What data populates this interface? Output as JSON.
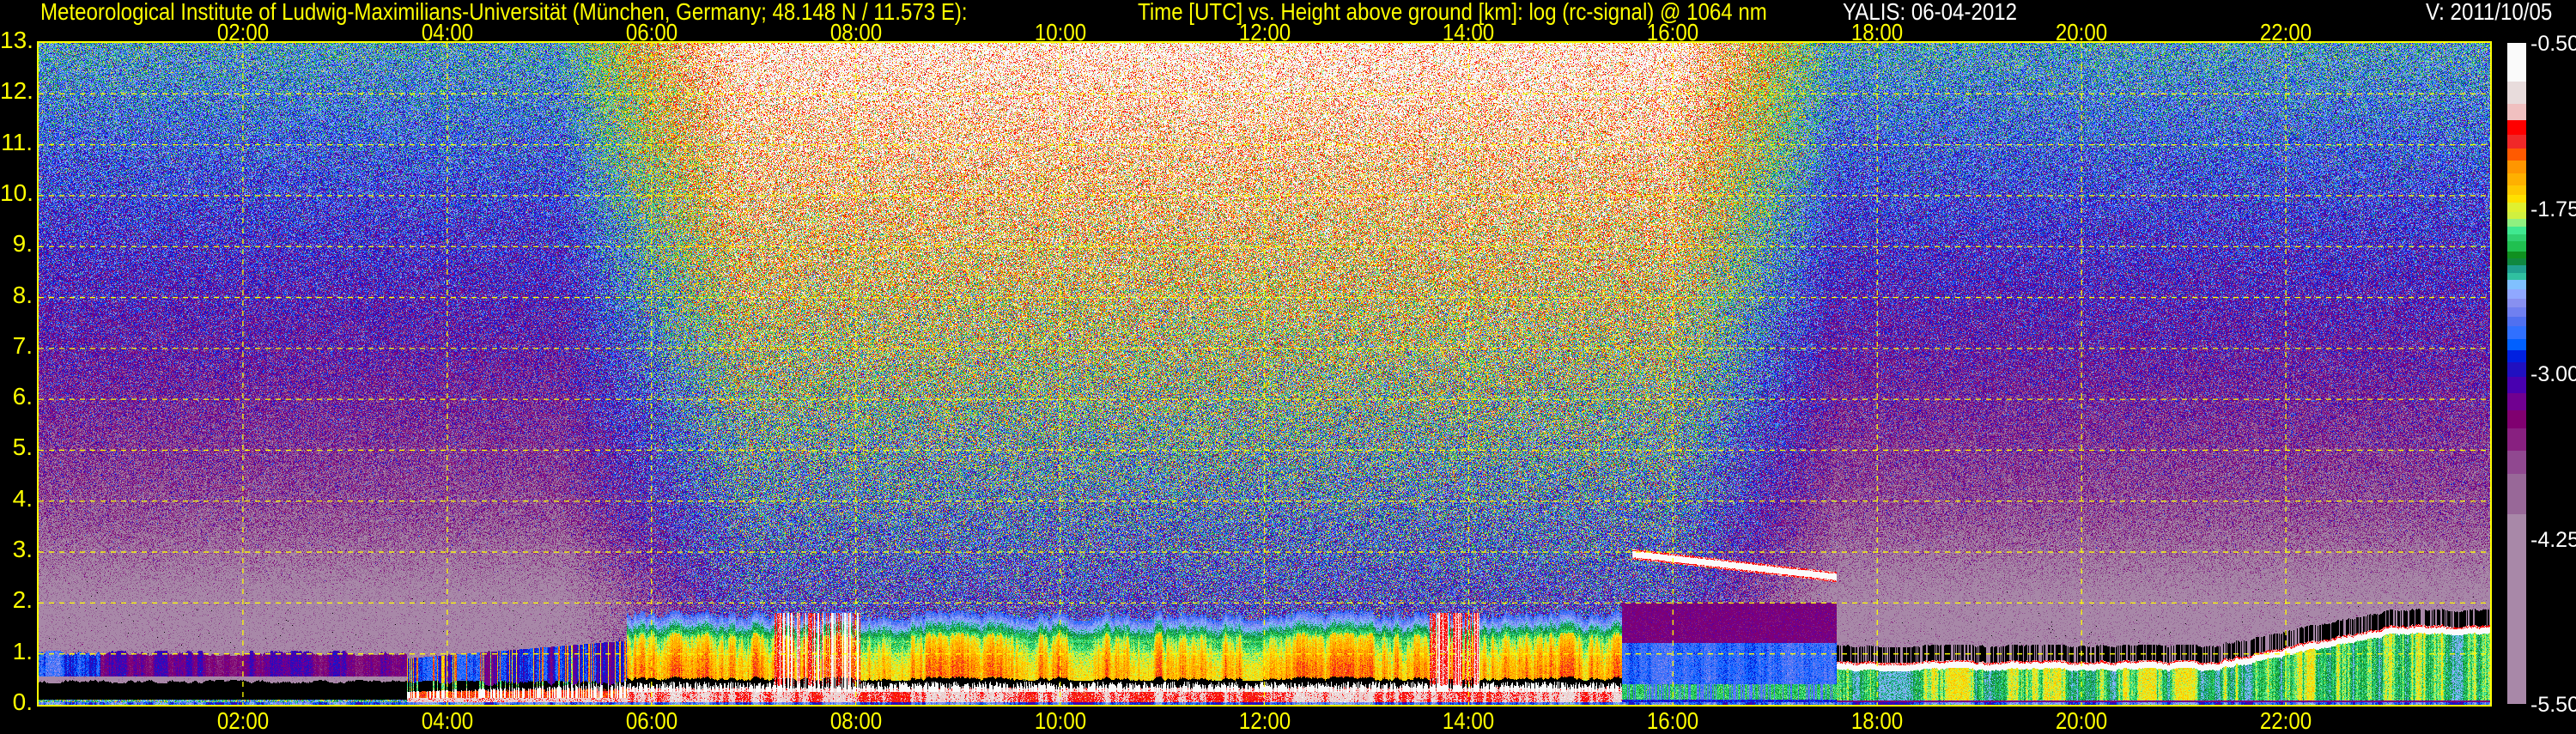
{
  "header": {
    "institute": "Meteorological Institute of Ludwig-Maximilians-Universität (München, Germany; 48.148 N / 11.573 E):",
    "plot_description": "Time [UTC] vs. Height above ground [km]: log (rc-signal) @ 1064 nm",
    "instrument_date": "YALIS: 06-04-2012",
    "version": "V: 2011/10/05"
  },
  "chart_data": {
    "type": "heatmap",
    "title": "Time [UTC] vs. Height above ground [km]: log (rc-signal) @ 1064 nm",
    "xlabel": "Time [UTC]",
    "ylabel": "Height above ground [km]",
    "xlim": [
      0,
      24
    ],
    "ylim": [
      0,
      13
    ],
    "grid": true,
    "x_ticks": [
      {
        "value": 2,
        "label": "02:00"
      },
      {
        "value": 4,
        "label": "04:00"
      },
      {
        "value": 6,
        "label": "06:00"
      },
      {
        "value": 8,
        "label": "08:00"
      },
      {
        "value": 10,
        "label": "10:00"
      },
      {
        "value": 12,
        "label": "12:00"
      },
      {
        "value": 14,
        "label": "14:00"
      },
      {
        "value": 16,
        "label": "16:00"
      },
      {
        "value": 18,
        "label": "18:00"
      },
      {
        "value": 20,
        "label": "20:00"
      },
      {
        "value": 22,
        "label": "22:00"
      }
    ],
    "y_ticks": [
      {
        "value": 0,
        "label": "0."
      },
      {
        "value": 1,
        "label": "1."
      },
      {
        "value": 2,
        "label": "2."
      },
      {
        "value": 3,
        "label": "3."
      },
      {
        "value": 4,
        "label": "4."
      },
      {
        "value": 5,
        "label": "5."
      },
      {
        "value": 6,
        "label": "6."
      },
      {
        "value": 7,
        "label": "7."
      },
      {
        "value": 8,
        "label": "8."
      },
      {
        "value": 9,
        "label": "9."
      },
      {
        "value": 10,
        "label": "10."
      },
      {
        "value": 11,
        "label": "11."
      },
      {
        "value": 12,
        "label": "12."
      },
      {
        "value": 13,
        "label": "13."
      }
    ],
    "structure": {
      "daylight_hours": [
        5.7,
        17.5
      ],
      "mixed_layer_top_km": 1.3,
      "night_layer_top_km": 0.8,
      "cloud_layer": {
        "start_h": 15.6,
        "end_h": 17.6,
        "height_km": [
          2.95,
          2.5
        ]
      }
    },
    "colorbar": {
      "range": [
        -5.5,
        -0.5
      ],
      "labels": [
        {
          "value": -0.5,
          "label": "-0.50"
        },
        {
          "value": -1.75,
          "label": "-1.75"
        },
        {
          "value": -3.0,
          "label": "-3.00"
        },
        {
          "value": -4.25,
          "label": "-4.25"
        },
        {
          "value": -5.5,
          "label": "-5.50"
        }
      ],
      "segments": [
        {
          "min": -0.792,
          "color": "#fafafa"
        },
        {
          "min": -0.958,
          "color": "#e8dcdc"
        },
        {
          "min": -1.085,
          "color": "#f0c0c0"
        },
        {
          "min": -1.197,
          "color": "#ff0000"
        },
        {
          "min": -1.296,
          "color": "#f02828"
        },
        {
          "min": -1.391,
          "color": "#ff5a00"
        },
        {
          "min": -1.489,
          "color": "#ff9600"
        },
        {
          "min": -1.577,
          "color": "#ffb000"
        },
        {
          "min": -1.648,
          "color": "#ffc800"
        },
        {
          "min": -1.711,
          "color": "#ffe000"
        },
        {
          "min": -1.778,
          "color": "#e0f030"
        },
        {
          "min": -1.831,
          "color": "#d0f040"
        },
        {
          "min": -1.891,
          "color": "#90f080"
        },
        {
          "min": -1.947,
          "color": "#40e890"
        },
        {
          "min": -2.0,
          "color": "#30d070"
        },
        {
          "min": -2.077,
          "color": "#20c050"
        },
        {
          "min": -2.13,
          "color": "#109020"
        },
        {
          "min": -2.183,
          "color": "#108840"
        },
        {
          "min": -2.243,
          "color": "#20a090"
        },
        {
          "min": -2.292,
          "color": "#30c0a0"
        },
        {
          "min": -2.366,
          "color": "#80c0ff"
        },
        {
          "min": -2.433,
          "color": "#90a8ff"
        },
        {
          "min": -2.5,
          "color": "#8890f0"
        },
        {
          "min": -2.57,
          "color": "#7080f0"
        },
        {
          "min": -2.641,
          "color": "#5070f0"
        },
        {
          "min": -2.739,
          "color": "#3070ff"
        },
        {
          "min": -2.824,
          "color": "#0060ff"
        },
        {
          "min": -2.915,
          "color": "#0020e0"
        },
        {
          "min": -3.028,
          "color": "#2010c0"
        },
        {
          "min": -3.151,
          "color": "#4800b0"
        },
        {
          "min": -3.282,
          "color": "#700090"
        },
        {
          "min": -3.415,
          "color": "#800070"
        },
        {
          "min": -3.585,
          "color": "#882080"
        },
        {
          "min": -3.761,
          "color": "#904890"
        },
        {
          "min": -4.067,
          "color": "#986898"
        },
        {
          "min": -5.5,
          "color": "#a888a8"
        }
      ]
    }
  },
  "colors": {
    "axis": "#ffff00",
    "header_secondary": "#ffffff",
    "background": "#000000"
  }
}
